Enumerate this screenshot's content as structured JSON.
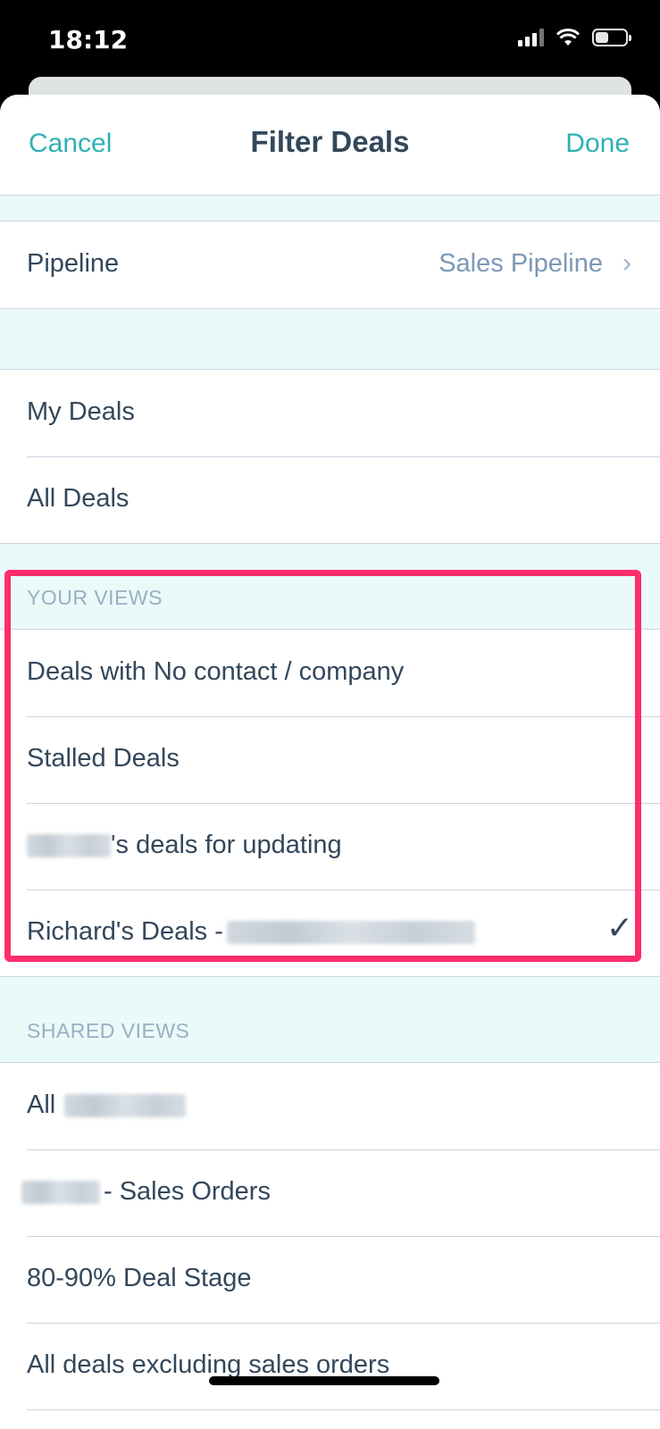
{
  "status_bar": {
    "time": "18:12"
  },
  "nav": {
    "cancel": "Cancel",
    "title": "Filter Deals",
    "done": "Done"
  },
  "pipeline": {
    "label": "Pipeline",
    "value": "Sales Pipeline"
  },
  "default_views": [
    "My Deals",
    "All Deals"
  ],
  "your_views": {
    "header": "YOUR VIEWS",
    "items": [
      "Deals with No contact / company",
      "Stalled Deals",
      "'s deals for updating",
      "Richard's Deals -"
    ],
    "selected_index": 3
  },
  "shared_views": {
    "header": "SHARED VIEWS",
    "items": [
      "All",
      "- Sales Orders",
      "80-90% Deal Stage",
      "All deals excluding sales orders"
    ]
  },
  "icons": {
    "chevron": "chevron-right-icon",
    "check": "checkmark-icon"
  },
  "colors": {
    "accent": "#2fb0b4",
    "highlight": "#ff2d6b",
    "text": "#33475b"
  }
}
